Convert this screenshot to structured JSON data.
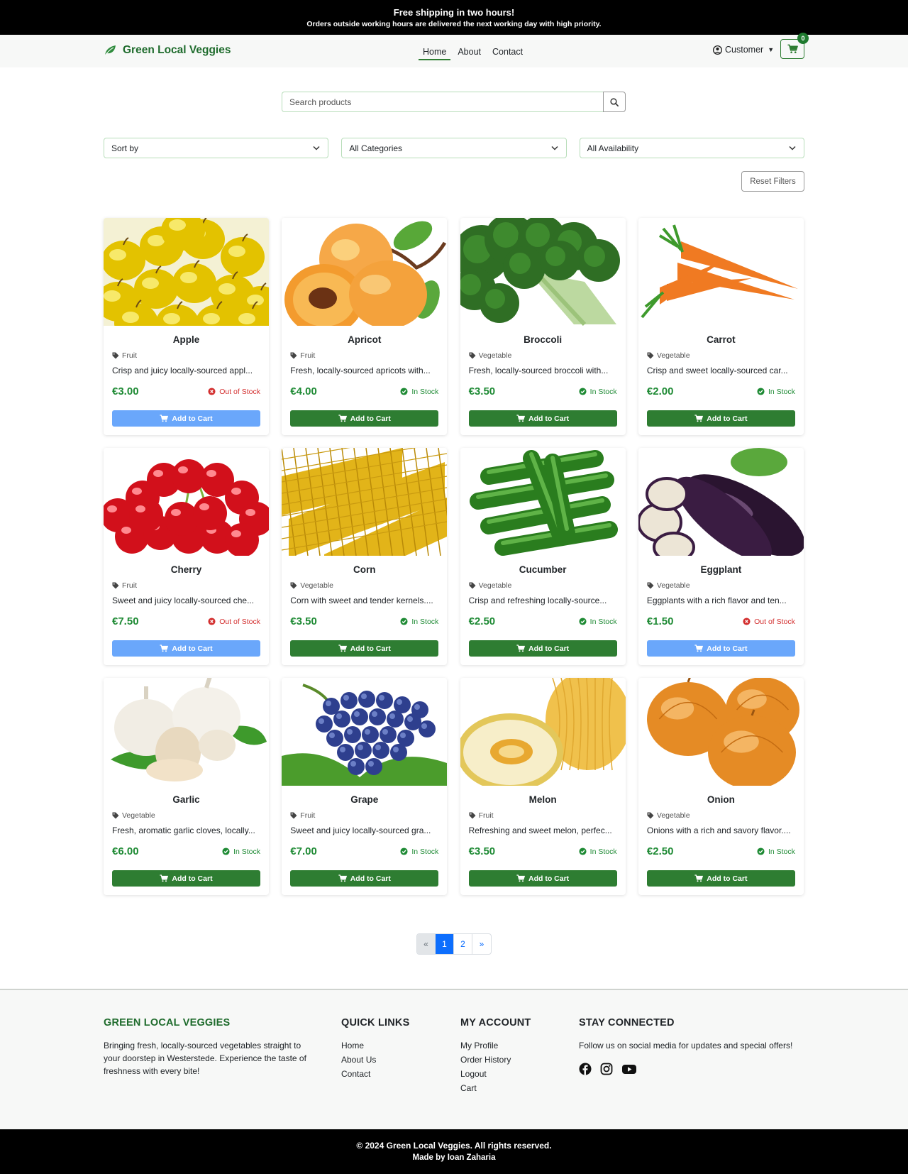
{
  "banner": {
    "title": "Free shipping in two hours!",
    "subtitle": "Orders outside working hours are delivered the next working day with high priority."
  },
  "nav": {
    "brand": "Green Local Veggies",
    "links": [
      "Home",
      "About",
      "Contact"
    ],
    "active": "Home",
    "account_label": "Customer",
    "cart_count": "0"
  },
  "search": {
    "placeholder": "Search products"
  },
  "filters": {
    "sort": "Sort by",
    "category": "All Categories",
    "availability": "All Availability",
    "reset_label": "Reset Filters"
  },
  "products": [
    {
      "name": "Apple",
      "category": "Fruit",
      "description": "Crisp and juicy locally-sourced appl...",
      "price": "€3.00",
      "stock": "Out of Stock",
      "in_stock": false,
      "button": "Add to Cart"
    },
    {
      "name": "Apricot",
      "category": "Fruit",
      "description": "Fresh, locally-sourced apricots with...",
      "price": "€4.00",
      "stock": "In Stock",
      "in_stock": true,
      "button": "Add to Cart"
    },
    {
      "name": "Broccoli",
      "category": "Vegetable",
      "description": "Fresh, locally-sourced broccoli with...",
      "price": "€3.50",
      "stock": "In Stock",
      "in_stock": true,
      "button": "Add to Cart"
    },
    {
      "name": "Carrot",
      "category": "Vegetable",
      "description": "Crisp and sweet locally-sourced car...",
      "price": "€2.00",
      "stock": "In Stock",
      "in_stock": true,
      "button": "Add to Cart"
    },
    {
      "name": "Cherry",
      "category": "Fruit",
      "description": "Sweet and juicy locally-sourced che...",
      "price": "€7.50",
      "stock": "Out of Stock",
      "in_stock": false,
      "button": "Add to Cart"
    },
    {
      "name": "Corn",
      "category": "Vegetable",
      "description": "Corn with sweet and tender kernels....",
      "price": "€3.50",
      "stock": "In Stock",
      "in_stock": true,
      "button": "Add to Cart"
    },
    {
      "name": "Cucumber",
      "category": "Vegetable",
      "description": "Crisp and refreshing locally-source...",
      "price": "€2.50",
      "stock": "In Stock",
      "in_stock": true,
      "button": "Add to Cart"
    },
    {
      "name": "Eggplant",
      "category": "Vegetable",
      "description": "Eggplants with a rich flavor and ten...",
      "price": "€1.50",
      "stock": "Out of Stock",
      "in_stock": false,
      "button": "Add to Cart"
    },
    {
      "name": "Garlic",
      "category": "Vegetable",
      "description": "Fresh, aromatic garlic cloves, locally...",
      "price": "€6.00",
      "stock": "In Stock",
      "in_stock": true,
      "button": "Add to Cart"
    },
    {
      "name": "Grape",
      "category": "Fruit",
      "description": "Sweet and juicy locally-sourced gra...",
      "price": "€7.00",
      "stock": "In Stock",
      "in_stock": true,
      "button": "Add to Cart"
    },
    {
      "name": "Melon",
      "category": "Fruit",
      "description": "Refreshing and sweet melon, perfec...",
      "price": "€3.50",
      "stock": "In Stock",
      "in_stock": true,
      "button": "Add to Cart"
    },
    {
      "name": "Onion",
      "category": "Vegetable",
      "description": "Onions with a rich and savory flavor....",
      "price": "€2.50",
      "stock": "In Stock",
      "in_stock": true,
      "button": "Add to Cart"
    }
  ],
  "pagination": {
    "prev": "«",
    "pages": [
      "1",
      "2"
    ],
    "current": "1",
    "next": "»"
  },
  "footer": {
    "brand_heading": "GREEN LOCAL VEGGIES",
    "about": "Bringing fresh, locally-sourced vegetables straight to your doorstep in Westerstede. Experience the taste of freshness with every bite!",
    "quick_links_heading": "QUICK LINKS",
    "quick_links": [
      "Home",
      "About Us",
      "Contact"
    ],
    "account_heading": "MY ACCOUNT",
    "account_links": [
      "My Profile",
      "Order History",
      "Logout",
      "Cart"
    ],
    "social_heading": "STAY CONNECTED",
    "social_text": "Follow us on social media for updates and special offers!",
    "social_icons": [
      "facebook-icon",
      "instagram-icon",
      "youtube-icon"
    ]
  },
  "bottom": {
    "copyright": "© 2024 Green Local Veggies. All rights reserved.",
    "credit": "Made by Ioan Zaharia"
  },
  "colors": {
    "brand_green": "#1e6b2c",
    "price_green": "#1e8a34",
    "button_green": "#2e7d32",
    "button_disabled": "#6aa7fb",
    "out_of_stock": "#d32f2f",
    "page_active": "#0d6efd"
  }
}
